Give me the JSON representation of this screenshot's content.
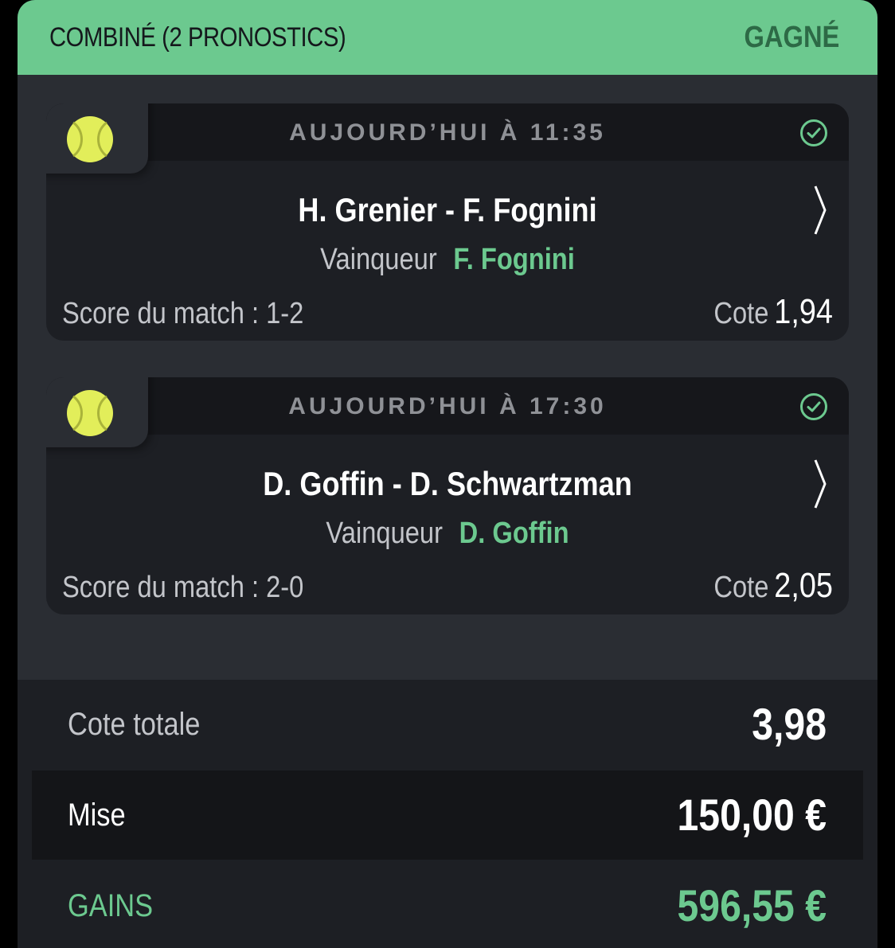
{
  "header": {
    "title": "COMBINÉ  (2 PRONOSTICS)",
    "status": "GAGNÉ"
  },
  "colors": {
    "accent_green": "#6cc98f",
    "status_dark_green": "#2d6a46",
    "panel_bg": "#2a2d33",
    "card_bg": "#1d1f24",
    "ball_yellow": "#e2ee5a"
  },
  "bets": [
    {
      "sport_icon": "tennis-ball-icon",
      "time": "AUJOURD’HUI À 11:35",
      "status_icon": "check-circle-icon",
      "match": "H. Grenier - F. Fognini",
      "market": "Vainqueur",
      "selection": "F. Fognini",
      "score": "Score du match : 1-2",
      "odds_label": "Cote",
      "odds_value": "1,94"
    },
    {
      "sport_icon": "tennis-ball-icon",
      "time": "AUJOURD’HUI À 17:30",
      "status_icon": "check-circle-icon",
      "match": "D. Goffin - D. Schwartzman",
      "market": "Vainqueur",
      "selection": "D. Goffin",
      "score": "Score du match : 2-0",
      "odds_label": "Cote",
      "odds_value": "2,05"
    }
  ],
  "summary": {
    "total_odds_label": "Cote totale",
    "total_odds_value": "3,98",
    "stake_label": "Mise",
    "stake_value": "150,00 €",
    "winnings_label": "GAINS",
    "winnings_value": "596,55 €"
  }
}
